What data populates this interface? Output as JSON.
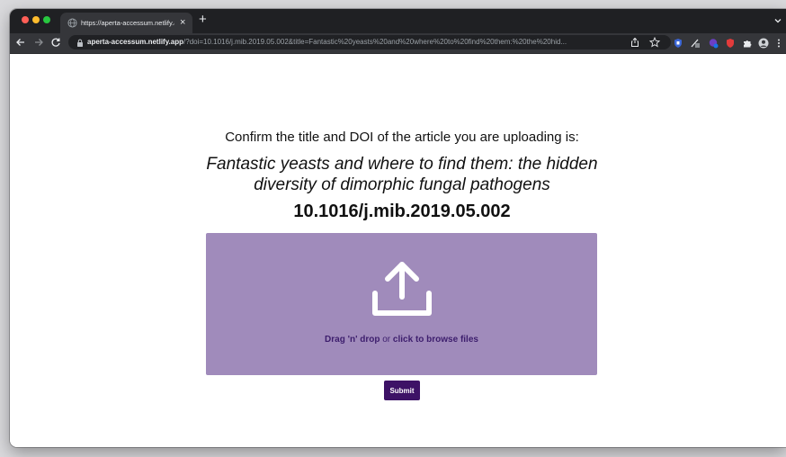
{
  "browser": {
    "tab_title": "https://aperta-accessum.netlify.app",
    "new_tab_label": "+",
    "tab_close_label": "×",
    "url_host": "aperta-accessum.netlify.app",
    "url_rest": "/?doi=10.1016/j.mib.2019.05.002&title=Fantastic%20yeasts%20and%20where%20to%20find%20them:%20the%20hid..."
  },
  "page": {
    "confirm_text": "Confirm the title and DOI of the article you are uploading is:",
    "article_title": "Fantastic yeasts and where to find them: the hidden diversity of dimorphic fungal pathogens",
    "doi": "10.1016/j.mib.2019.05.002",
    "dropzone": {
      "drag_label": "Drag 'n' drop",
      "or_label": "or",
      "browse_label": "click to browse files",
      "icon": "upload-icon"
    },
    "submit_label": "Submit"
  },
  "colors": {
    "dropzone_bg": "#a08bbb",
    "accent": "#3d1266"
  }
}
